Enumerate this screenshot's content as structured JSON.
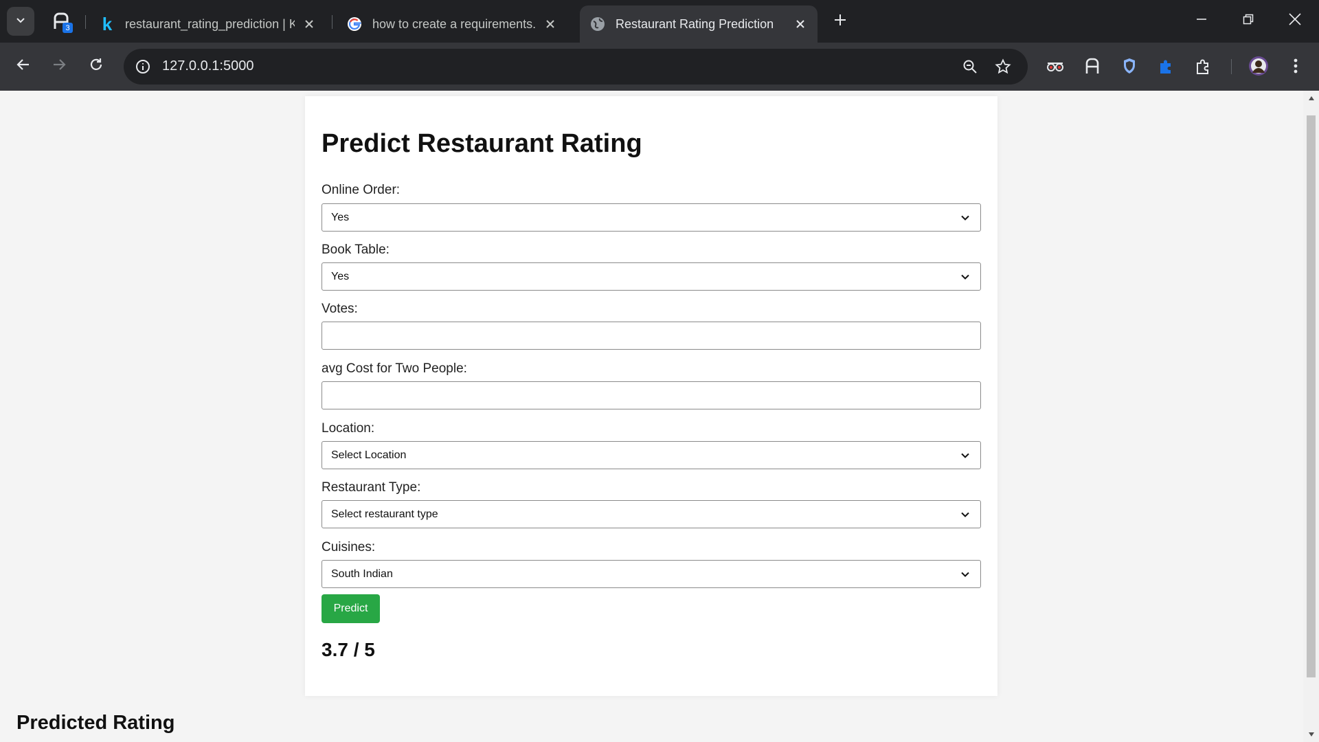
{
  "browser": {
    "tabs": [
      {
        "title": "restaurant_rating_prediction | K",
        "icon": "kaggle-icon"
      },
      {
        "title": "how to create a requirements.tx",
        "icon": "google-icon"
      },
      {
        "title": "Restaurant Rating Prediction",
        "icon": "globe-icon",
        "active": true
      }
    ],
    "pinned_badge": "3",
    "address": "127.0.0.1:5000",
    "accent_color": "#8ab4f8"
  },
  "page": {
    "title": "Predict Restaurant Rating",
    "fields": {
      "online_order": {
        "label": "Online Order:",
        "value": "Yes"
      },
      "book_table": {
        "label": "Book Table:",
        "value": "Yes"
      },
      "votes": {
        "label": "Votes:",
        "value": ""
      },
      "avg_cost": {
        "label": "avg Cost for Two People:",
        "value": ""
      },
      "location": {
        "label": "Location:",
        "value": "Select Location"
      },
      "restaurant_type": {
        "label": "Restaurant Type:",
        "value": "Select restaurant type"
      },
      "cuisines": {
        "label": "Cuisines:",
        "value": "South Indian"
      }
    },
    "predict_button": "Predict",
    "predict_button_color": "#28a745",
    "result": "3.7 / 5",
    "predicted_heading": "Predicted Rating"
  }
}
